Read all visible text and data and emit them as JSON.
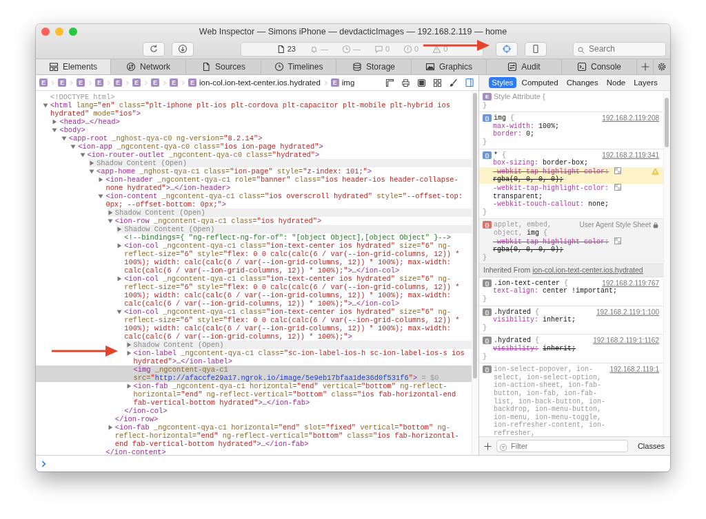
{
  "window": {
    "title": "Web Inspector — Simons iPhone — devdacticImages — 192.168.2.119 — home"
  },
  "toolbar": {
    "activity": [
      {
        "value": "23"
      },
      {
        "value": "—"
      },
      {
        "value": "—"
      },
      {
        "value": "0"
      },
      {
        "value": "0"
      },
      {
        "value": "0"
      }
    ],
    "inspect_mode": {
      "on": true
    },
    "search": {
      "placeholder": "Search"
    }
  },
  "tabs": [
    {
      "label": "Elements",
      "selected": true
    },
    {
      "label": "Network",
      "selected": false
    },
    {
      "label": "Sources",
      "selected": false
    },
    {
      "label": "Timelines",
      "selected": false
    },
    {
      "label": "Storage",
      "selected": false
    },
    {
      "label": "Graphics",
      "selected": false
    },
    {
      "label": "Audit",
      "selected": false
    },
    {
      "label": "Console",
      "selected": false
    }
  ],
  "breadcrumbs": [
    {
      "badge": "E"
    },
    {
      "badge": "E"
    },
    {
      "badge": "E"
    },
    {
      "badge": "E"
    },
    {
      "badge": "E"
    },
    {
      "badge": "E"
    },
    {
      "badge": "E"
    },
    {
      "badge": "E"
    },
    {
      "badge": "E",
      "label": "ion-col.ion-text-center.ios.hydrated"
    },
    {
      "badge": "E",
      "label": "img"
    }
  ],
  "details_sidebar": {
    "on": true
  },
  "dom_tree": [
    {
      "kind": "leaf",
      "selected": false,
      "tokens": [
        {
          "kind": "muted",
          "text": "<!DOCTYPE html>"
        }
      ]
    },
    {
      "kind": "element",
      "expanded": true,
      "selected": false,
      "tokens": [
        {
          "kind": "tag",
          "text": "<html"
        },
        {
          "kind": "attr",
          "text": " lang="
        },
        {
          "kind": "value",
          "text": "\"en\""
        },
        {
          "kind": "attr",
          "text": " class="
        },
        {
          "kind": "value",
          "text": "\"plt-iphone plt-ios plt-cordova plt-capacitor plt-mobile plt-hybrid ios hydrated\""
        },
        {
          "kind": "attr",
          "text": " mode="
        },
        {
          "kind": "value",
          "text": "\"ios\""
        },
        {
          "kind": "tag",
          "text": ">"
        }
      ],
      "children": [
        {
          "kind": "element",
          "expanded": false,
          "selected": false,
          "tokens": [
            {
              "kind": "tag",
              "text": "<head>"
            },
            {
              "kind": "ellipsis",
              "text": "…"
            },
            {
              "kind": "tag",
              "text": "</head>"
            }
          ]
        },
        {
          "kind": "element",
          "expanded": true,
          "selected": false,
          "tokens": [
            {
              "kind": "tag",
              "text": "<body>"
            }
          ],
          "children": [
            {
              "kind": "element",
              "expanded": true,
              "selected": false,
              "tokens": [
                {
                  "kind": "tag",
                  "text": "<app-root"
                },
                {
                  "kind": "attr",
                  "text": " _nghost-qya-c0 ng-version="
                },
                {
                  "kind": "value",
                  "text": "\"8.2.14\""
                },
                {
                  "kind": "tag",
                  "text": ">"
                }
              ],
              "children": [
                {
                  "kind": "element",
                  "expanded": true,
                  "selected": false,
                  "tokens": [
                    {
                      "kind": "tag",
                      "text": "<ion-app"
                    },
                    {
                      "kind": "attr",
                      "text": " _ngcontent-qya-c0 class="
                    },
                    {
                      "kind": "value",
                      "text": "\"ios ion-page hydrated\""
                    },
                    {
                      "kind": "tag",
                      "text": ">"
                    }
                  ],
                  "children": [
                    {
                      "kind": "element",
                      "expanded": true,
                      "selected": false,
                      "tokens": [
                        {
                          "kind": "tag",
                          "text": "<ion-router-outlet"
                        },
                        {
                          "kind": "attr",
                          "text": " _ngcontent-qya-c0 class="
                        },
                        {
                          "kind": "value",
                          "text": "\"hydrated\""
                        },
                        {
                          "kind": "tag",
                          "text": ">"
                        }
                      ],
                      "children": [
                        {
                          "kind": "shadow",
                          "expanded": false,
                          "selected": false,
                          "text": "Shadow Content (Open)"
                        },
                        {
                          "kind": "element",
                          "expanded": true,
                          "selected": false,
                          "tokens": [
                            {
                              "kind": "tag",
                              "text": "<app-home"
                            },
                            {
                              "kind": "attr",
                              "text": " _nghost-qya-c1 class="
                            },
                            {
                              "kind": "value",
                              "text": "\"ion-page\""
                            },
                            {
                              "kind": "attr",
                              "text": " style="
                            },
                            {
                              "kind": "value",
                              "text": "\"z-index: 101;\""
                            },
                            {
                              "kind": "tag",
                              "text": ">"
                            }
                          ],
                          "children": [
                            {
                              "kind": "element",
                              "expanded": false,
                              "selected": false,
                              "tokens": [
                                {
                                  "kind": "tag",
                                  "text": "<ion-header"
                                },
                                {
                                  "kind": "attr",
                                  "text": " _ngcontent-qya-c1 role="
                                },
                                {
                                  "kind": "value",
                                  "text": "\"banner\""
                                },
                                {
                                  "kind": "attr",
                                  "text": " class="
                                },
                                {
                                  "kind": "value",
                                  "text": "\"ios header-ios header-collapse-none hydrated\""
                                },
                                {
                                  "kind": "tag",
                                  "text": ">"
                                },
                                {
                                  "kind": "ellipsis",
                                  "text": "…"
                                },
                                {
                                  "kind": "tag",
                                  "text": "</ion-header>"
                                }
                              ]
                            },
                            {
                              "kind": "element",
                              "expanded": true,
                              "selected": false,
                              "tokens": [
                                {
                                  "kind": "tag",
                                  "text": "<ion-content"
                                },
                                {
                                  "kind": "attr",
                                  "text": " _ngcontent-qya-c1 class="
                                },
                                {
                                  "kind": "value",
                                  "text": "\"ios overscroll hydrated\""
                                },
                                {
                                  "kind": "attr",
                                  "text": " style="
                                },
                                {
                                  "kind": "value",
                                  "text": "\"--offset-top: 0px; --offset-bottom: 0px;\""
                                },
                                {
                                  "kind": "tag",
                                  "text": ">"
                                }
                              ],
                              "closing": "</ion-content>",
                              "children": [
                                {
                                  "kind": "shadow",
                                  "expanded": false,
                                  "selected": false,
                                  "text": "Shadow Content (Open)"
                                },
                                {
                                  "kind": "element",
                                  "expanded": true,
                                  "selected": false,
                                  "tokens": [
                                    {
                                      "kind": "tag",
                                      "text": "<ion-row"
                                    },
                                    {
                                      "kind": "attr",
                                      "text": " _ngcontent-qya-c1 class="
                                    },
                                    {
                                      "kind": "value",
                                      "text": "\"ios hydrated\""
                                    },
                                    {
                                      "kind": "tag",
                                      "text": ">"
                                    }
                                  ],
                                  "closing": "</ion-row>",
                                  "children": [
                                    {
                                      "kind": "shadow",
                                      "expanded": false,
                                      "selected": false,
                                      "text": "Shadow Content (Open)"
                                    },
                                    {
                                      "kind": "leaf",
                                      "selected": false,
                                      "tokens": [
                                        {
                                          "kind": "comment",
                                          "text": "<!--bindings={ \"ng-reflect-ng-for-of\": \"[object Object],[object Object\" }-->"
                                        }
                                      ]
                                    },
                                    {
                                      "kind": "element",
                                      "expanded": false,
                                      "selected": false,
                                      "tokens": [
                                        {
                                          "kind": "tag",
                                          "text": "<ion-col"
                                        },
                                        {
                                          "kind": "attr",
                                          "text": " _ngcontent-qya-c1 class="
                                        },
                                        {
                                          "kind": "value",
                                          "text": "\"ion-text-center ios hydrated\""
                                        },
                                        {
                                          "kind": "attr",
                                          "text": " size="
                                        },
                                        {
                                          "kind": "value",
                                          "text": "\"6\""
                                        },
                                        {
                                          "kind": "attr",
                                          "text": " ng-reflect-size="
                                        },
                                        {
                                          "kind": "value",
                                          "text": "\"6\""
                                        },
                                        {
                                          "kind": "attr",
                                          "text": " style="
                                        },
                                        {
                                          "kind": "value",
                                          "text": "\"flex: 0 0 calc(calc(6 / var(--ion-grid-columns, 12)) * 100%); width: calc(calc(6 / var(--ion-grid-columns, 12)) * 100%); max-width: calc(calc(6 / var(--ion-grid-columns, 12)) * 100%);\""
                                        },
                                        {
                                          "kind": "tag",
                                          "text": ">"
                                        },
                                        {
                                          "kind": "ellipsis",
                                          "text": "…"
                                        },
                                        {
                                          "kind": "tag",
                                          "text": "</ion-col>"
                                        }
                                      ]
                                    },
                                    {
                                      "kind": "element",
                                      "expanded": false,
                                      "selected": false,
                                      "tokens": [
                                        {
                                          "kind": "tag",
                                          "text": "<ion-col"
                                        },
                                        {
                                          "kind": "attr",
                                          "text": " _ngcontent-qya-c1 class="
                                        },
                                        {
                                          "kind": "value",
                                          "text": "\"ion-text-center ios hydrated\""
                                        },
                                        {
                                          "kind": "attr",
                                          "text": " size="
                                        },
                                        {
                                          "kind": "value",
                                          "text": "\"6\""
                                        },
                                        {
                                          "kind": "attr",
                                          "text": " ng-reflect-size="
                                        },
                                        {
                                          "kind": "value",
                                          "text": "\"6\""
                                        },
                                        {
                                          "kind": "attr",
                                          "text": " style="
                                        },
                                        {
                                          "kind": "value",
                                          "text": "\"flex: 0 0 calc(calc(6 / var(--ion-grid-columns, 12)) * 100%); width: calc(calc(6 / var(--ion-grid-columns, 12)) * 100%); max-width: calc(calc(6 / var(--ion-grid-columns, 12)) * 100%);\""
                                        },
                                        {
                                          "kind": "tag",
                                          "text": ">"
                                        },
                                        {
                                          "kind": "ellipsis",
                                          "text": "…"
                                        },
                                        {
                                          "kind": "tag",
                                          "text": "</ion-col>"
                                        }
                                      ]
                                    },
                                    {
                                      "kind": "element",
                                      "expanded": true,
                                      "selected": false,
                                      "tokens": [
                                        {
                                          "kind": "tag",
                                          "text": "<ion-col"
                                        },
                                        {
                                          "kind": "attr",
                                          "text": " _ngcontent-qya-c1 class="
                                        },
                                        {
                                          "kind": "value",
                                          "text": "\"ion-text-center ios hydrated\""
                                        },
                                        {
                                          "kind": "attr",
                                          "text": " size="
                                        },
                                        {
                                          "kind": "value",
                                          "text": "\"6\""
                                        },
                                        {
                                          "kind": "attr",
                                          "text": " ng-reflect-size="
                                        },
                                        {
                                          "kind": "value",
                                          "text": "\"6\""
                                        },
                                        {
                                          "kind": "attr",
                                          "text": " style="
                                        },
                                        {
                                          "kind": "value",
                                          "text": "\"flex: 0 0 calc(calc(6 / var(--ion-grid-columns, 12)) * 100%); width: calc(calc(6 / var(--ion-grid-columns, 12)) * 100%); max-width: calc(calc(6 / var(--ion-grid-columns, 12)) * 100%);\""
                                        },
                                        {
                                          "kind": "tag",
                                          "text": ">"
                                        }
                                      ],
                                      "closing": "</ion-col>",
                                      "children": [
                                        {
                                          "kind": "shadow",
                                          "expanded": false,
                                          "selected": false,
                                          "text": "Shadow Content (Open)"
                                        },
                                        {
                                          "kind": "element",
                                          "expanded": false,
                                          "selected": false,
                                          "tokens": [
                                            {
                                              "kind": "tag",
                                              "text": "<ion-label"
                                            },
                                            {
                                              "kind": "attr",
                                              "text": " _ngcontent-qya-c1 class="
                                            },
                                            {
                                              "kind": "value",
                                              "text": "\"sc-ion-label-ios-h sc-ion-label-ios-s ios hydrated\""
                                            },
                                            {
                                              "kind": "tag",
                                              "text": ">"
                                            },
                                            {
                                              "kind": "ellipsis",
                                              "text": "…"
                                            },
                                            {
                                              "kind": "tag",
                                              "text": "</ion-label>"
                                            }
                                          ]
                                        },
                                        {
                                          "kind": "leaf",
                                          "selected": true,
                                          "tokens": [
                                            {
                                              "kind": "tag",
                                              "text": "<img"
                                            },
                                            {
                                              "kind": "attr",
                                              "text": " _ngcontent-qya-c1 src="
                                            },
                                            {
                                              "kind": "value",
                                              "text": "\""
                                            },
                                            {
                                              "kind": "link",
                                              "text": "http://afaccfe29a17.ngrok.io/image/5e9eb17bfaa1de36d0f531f6"
                                            },
                                            {
                                              "kind": "value",
                                              "text": "\""
                                            },
                                            {
                                              "kind": "tag",
                                              "text": ">"
                                            },
                                            {
                                              "kind": "muted",
                                              "text": " = $0"
                                            }
                                          ]
                                        },
                                        {
                                          "kind": "element",
                                          "expanded": false,
                                          "selected": false,
                                          "tokens": [
                                            {
                                              "kind": "tag",
                                              "text": "<ion-fab"
                                            },
                                            {
                                              "kind": "attr",
                                              "text": " _ngcontent-qya-c1 horizontal="
                                            },
                                            {
                                              "kind": "value",
                                              "text": "\"end\""
                                            },
                                            {
                                              "kind": "attr",
                                              "text": " vertical="
                                            },
                                            {
                                              "kind": "value",
                                              "text": "\"bottom\""
                                            },
                                            {
                                              "kind": "attr",
                                              "text": " ng-reflect-horizontal="
                                            },
                                            {
                                              "kind": "value",
                                              "text": "\"end\""
                                            },
                                            {
                                              "kind": "attr",
                                              "text": " ng-reflect-vertical="
                                            },
                                            {
                                              "kind": "value",
                                              "text": "\"bottom\""
                                            },
                                            {
                                              "kind": "attr",
                                              "text": " class="
                                            },
                                            {
                                              "kind": "value",
                                              "text": "\"ios fab-horizontal-end fab-vertical-bottom hydrated\""
                                            },
                                            {
                                              "kind": "tag",
                                              "text": ">"
                                            },
                                            {
                                              "kind": "ellipsis",
                                              "text": "…"
                                            },
                                            {
                                              "kind": "tag",
                                              "text": "</ion-fab>"
                                            }
                                          ]
                                        }
                                      ]
                                    }
                                  ]
                                },
                                {
                                  "kind": "element",
                                  "expanded": false,
                                  "selected": false,
                                  "tokens": [
                                    {
                                      "kind": "tag",
                                      "text": "<ion-fab"
                                    },
                                    {
                                      "kind": "attr",
                                      "text": " _ngcontent-qya-c1 horizontal="
                                    },
                                    {
                                      "kind": "value",
                                      "text": "\"end\""
                                    },
                                    {
                                      "kind": "attr",
                                      "text": " slot="
                                    },
                                    {
                                      "kind": "value",
                                      "text": "\"fixed\""
                                    },
                                    {
                                      "kind": "attr",
                                      "text": " vertical="
                                    },
                                    {
                                      "kind": "value",
                                      "text": "\"bottom\""
                                    },
                                    {
                                      "kind": "attr",
                                      "text": " ng-reflect-horizontal="
                                    },
                                    {
                                      "kind": "value",
                                      "text": "\"end\""
                                    },
                                    {
                                      "kind": "attr",
                                      "text": " ng-reflect-vertical="
                                    },
                                    {
                                      "kind": "value",
                                      "text": "\"bottom\""
                                    },
                                    {
                                      "kind": "attr",
                                      "text": " class="
                                    },
                                    {
                                      "kind": "value",
                                      "text": "\"ios fab-horizontal-end fab-vertical-bottom hydrated\""
                                    },
                                    {
                                      "kind": "tag",
                                      "text": ">"
                                    },
                                    {
                                      "kind": "ellipsis",
                                      "text": "…"
                                    },
                                    {
                                      "kind": "tag",
                                      "text": "</ion-fab>"
                                    }
                                  ]
                                }
                              ]
                            }
                          ]
                        }
                      ]
                    }
                  ]
                }
              ]
            }
          ]
        }
      ]
    }
  ],
  "styles_panel": {
    "tabs": [
      {
        "label": "Styles",
        "selected": true
      },
      {
        "label": "Computed",
        "selected": false
      },
      {
        "label": "Changes",
        "selected": false
      },
      {
        "label": "Node",
        "selected": false
      },
      {
        "label": "Layers",
        "selected": false
      }
    ],
    "rules": [
      {
        "kind": "element-rule",
        "badge": "E",
        "selector": [
          {
            "text": "Style Attribute",
            "matched": false
          },
          {
            "text": " {",
            "matched": false
          }
        ],
        "close": "}"
      },
      {
        "kind": "author-rule",
        "badge": "{}",
        "selector": [
          {
            "text": "img",
            "matched": true
          },
          {
            "text": " {",
            "matched": false
          }
        ],
        "source": "192.168.2.119:208",
        "locked": false,
        "props": [
          {
            "name": "max-width:",
            "value": "100%;",
            "struck": false,
            "warning": false,
            "swatch": false
          },
          {
            "name": "border:",
            "value": "0;",
            "struck": false,
            "warning": false,
            "swatch": false
          }
        ],
        "close": "}"
      },
      {
        "kind": "author-rule",
        "badge": "{}",
        "selector": [
          {
            "text": "*",
            "matched": true
          },
          {
            "text": " {",
            "matched": false
          }
        ],
        "source": "192.168.2.119:341",
        "locked": false,
        "props": [
          {
            "name": "box-sizing:",
            "value": "border-box;",
            "struck": false,
            "warning": false,
            "swatch": false
          },
          {
            "name": "-webkit-tap-highlight-color:",
            "value": "rgba(0, 0, 0, 0);",
            "struck": true,
            "warning": true,
            "swatch": true
          },
          {
            "name": "-webkit-tap-highlight-color:",
            "value": "transparent;",
            "struck": false,
            "warning": false,
            "swatch": true
          },
          {
            "name": "-webkit-touch-callout:",
            "value": "none;",
            "struck": false,
            "warning": false,
            "swatch": false
          }
        ],
        "close": "}"
      },
      {
        "kind": "user-agent-rule",
        "badge": "{}",
        "selector": [
          {
            "text": "applet, embed, object, ",
            "matched": false
          },
          {
            "text": "img",
            "matched": true
          },
          {
            "text": " {",
            "matched": false
          }
        ],
        "source": "User Agent Style Sheet",
        "locked": true,
        "props": [
          {
            "name": "-webkit-tap-highlight-color:",
            "value": "rgba(0, 0, 0, 0);",
            "struck": true,
            "warning": false,
            "swatch": true
          }
        ],
        "close": "}"
      },
      {
        "kind": "heading",
        "label": "Inherited From ",
        "link": "ion-col.ion-text-center.ios.hydrated"
      },
      {
        "kind": "inherited-rule",
        "badge": "{}",
        "selector": [
          {
            "text": ".ion-text-center",
            "matched": true
          },
          {
            "text": " {",
            "matched": false
          }
        ],
        "source": "192.168.2.119:767",
        "locked": false,
        "props": [
          {
            "name": "text-align:",
            "value": "center !important;",
            "struck": false,
            "warning": false,
            "swatch": false
          }
        ],
        "close": "}"
      },
      {
        "kind": "inherited-rule",
        "badge": "{}",
        "selector": [
          {
            "text": ".hydrated",
            "matched": true
          },
          {
            "text": " {",
            "matched": false
          }
        ],
        "source": "192.168.2.119:1:100",
        "locked": false,
        "props": [
          {
            "name": "visibility:",
            "value": "inherit;",
            "struck": false,
            "warning": false,
            "swatch": false
          }
        ],
        "close": "}"
      },
      {
        "kind": "inherited-rule",
        "badge": "{}",
        "selector": [
          {
            "text": ".hydrated",
            "matched": true
          },
          {
            "text": " {",
            "matched": false
          }
        ],
        "source": "192.168.2.119:1:1162",
        "locked": false,
        "props": [
          {
            "name": "visibility:",
            "value": "inherit;",
            "struck": true,
            "warning": false,
            "swatch": false
          }
        ],
        "close": "}"
      },
      {
        "kind": "inherited-rule",
        "badge": "{}",
        "selector": [
          {
            "text": "ion-select-popover, ion-select, ion-select-option, ion-action-sheet, ion-fab-button, ion-fab, ion-fab-list, ion-back-button, ion-backdrop, ion-menu-button, ion-menu, ion-menu-toggle, ion-refresher-content, ion-refresher,",
            "matched": false
          }
        ],
        "source": "192.168.2.119:1",
        "locked": false
      }
    ],
    "filter": {
      "placeholder": "Filter"
    },
    "classes_button": "Classes"
  }
}
